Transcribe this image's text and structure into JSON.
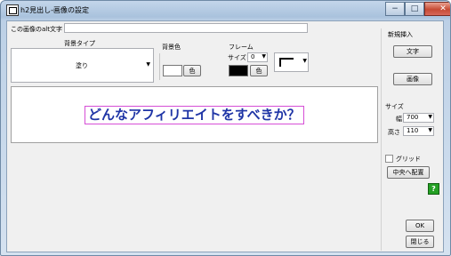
{
  "window": {
    "title": "h2見出し-画像の設定"
  },
  "caption": {
    "minimize": "−",
    "maximize": "□",
    "close": "✕"
  },
  "alt": {
    "label": "この画像のalt文字",
    "value": ""
  },
  "background_type": {
    "label": "背景タイプ",
    "value": "塗り"
  },
  "background_color": {
    "label": "背景色",
    "button": "色",
    "color": "#ffffff"
  },
  "frame": {
    "label": "フレーム",
    "size_label": "サイズ",
    "size_value": "0",
    "button": "色",
    "color": "#000000"
  },
  "preview": {
    "text": "どんなアフィリエイトをすべきか？",
    "text_color": "#1f35a6",
    "border_color": "#d64ed6"
  },
  "insert": {
    "label": "新規挿入",
    "text_button": "文字",
    "image_button": "画像"
  },
  "size": {
    "label": "サイズ",
    "width_label": "幅",
    "width_value": "700",
    "height_label": "高さ",
    "height_value": "110"
  },
  "grid": {
    "label": "グリッド",
    "checked": false
  },
  "center_button": "中央へ配置",
  "help_icon": "?",
  "ok_button": "OK",
  "close_button": "閉じる"
}
